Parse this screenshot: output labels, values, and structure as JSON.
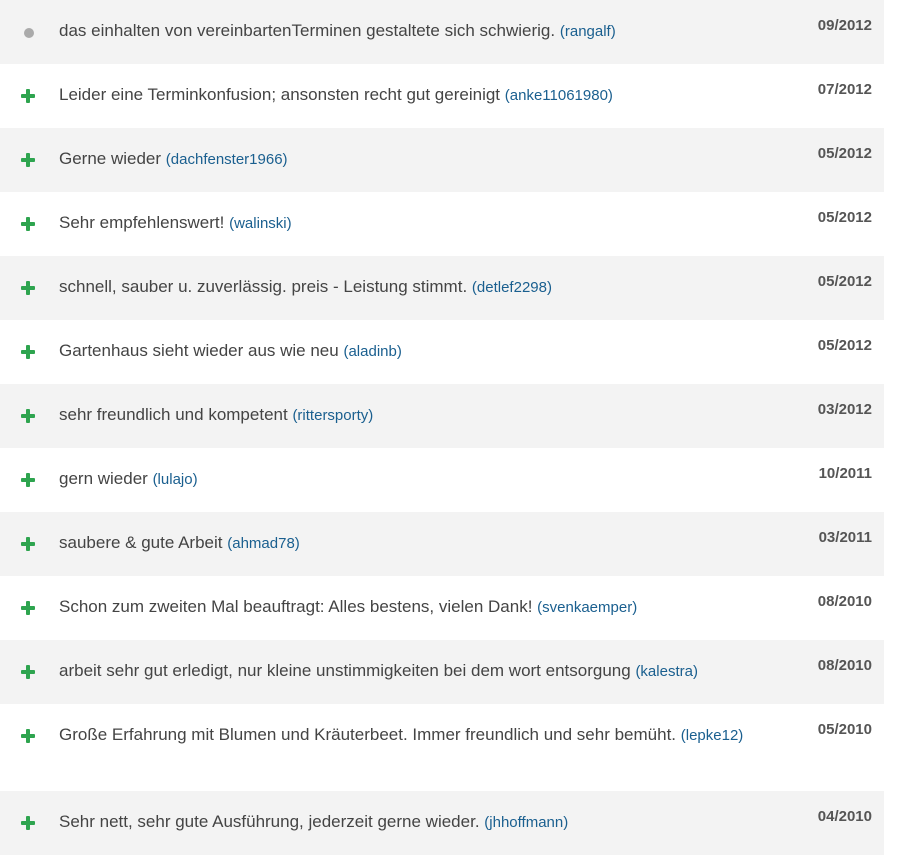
{
  "reviews": [
    {
      "icon": "neutral-dot-icon",
      "text": "das einhalten von vereinbartenTerminen gestaltete sich schwierig.",
      "user": "(rangalf)",
      "date": "09/2012"
    },
    {
      "icon": "plus-icon",
      "text": "Leider eine Terminkonfusion; ansonsten recht gut gereinigt",
      "user": "(anke11061980)",
      "date": "07/2012"
    },
    {
      "icon": "plus-icon",
      "text": "Gerne wieder",
      "user": "(dachfenster1966)",
      "date": "05/2012"
    },
    {
      "icon": "plus-icon",
      "text": "Sehr empfehlenswert!",
      "user": "(walinski)",
      "date": "05/2012"
    },
    {
      "icon": "plus-icon",
      "text": "schnell, sauber u. zuverlässig. preis - Leistung stimmt.",
      "user": "(detlef2298)",
      "date": "05/2012"
    },
    {
      "icon": "plus-icon",
      "text": "Gartenhaus sieht wieder aus wie neu",
      "user": "(aladinb)",
      "date": "05/2012"
    },
    {
      "icon": "plus-icon",
      "text": "sehr freundlich und kompetent",
      "user": "(rittersporty)",
      "date": "03/2012"
    },
    {
      "icon": "plus-icon",
      "text": "gern wieder",
      "user": "(lulajo)",
      "date": "10/2011"
    },
    {
      "icon": "plus-icon",
      "text": "saubere & gute Arbeit",
      "user": "(ahmad78)",
      "date": "03/2011"
    },
    {
      "icon": "plus-icon",
      "text": "Schon zum zweiten Mal beauftragt: Alles bestens, vielen Dank!",
      "user": "(svenkaemper)",
      "date": "08/2010"
    },
    {
      "icon": "plus-icon",
      "text": "arbeit sehr gut erledigt, nur kleine unstimmigkeiten bei dem wort entsorgung",
      "user": "(kalestra)",
      "date": "08/2010"
    },
    {
      "icon": "plus-icon",
      "text": "Große Erfahrung mit Blumen und Kräuterbeet. Immer freundlich und sehr bemüht.",
      "user": "(lepke12)",
      "date": "05/2010"
    },
    {
      "icon": "plus-icon",
      "text": "Sehr nett, sehr gute Ausführung, jederzeit gerne wieder.",
      "user": "(jhhoffmann)",
      "date": "04/2010"
    }
  ],
  "colors": {
    "positive": "#2ea44f",
    "neutral": "#aaaaaa",
    "username": "#1a5f8f",
    "row_shade": "#f3f3f3"
  }
}
